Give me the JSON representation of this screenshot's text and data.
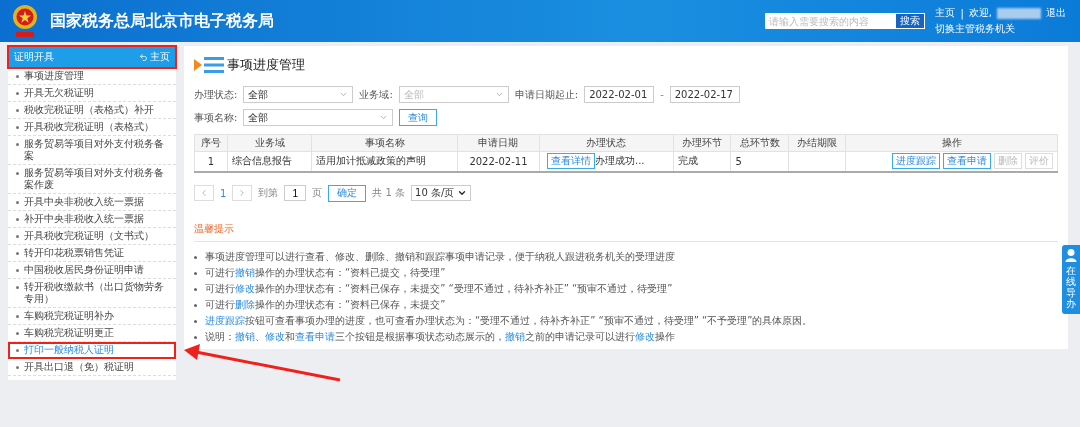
{
  "header": {
    "title": "国家税务总局北京市电子税务局",
    "search": {
      "placeholder": "请输入需要搜索的内容",
      "button": "搜索"
    },
    "home": "主页",
    "separator": "|",
    "welcome": "欢迎,",
    "logout": "退出",
    "switch_org": "切换主管税务机关"
  },
  "sidebar": {
    "title": "证明开具",
    "home_link": "主页",
    "annotated": true,
    "items": [
      {
        "label": "事项进度管理",
        "selected": false,
        "annotated": false
      },
      {
        "label": "开具无欠税证明",
        "selected": false,
        "annotated": false
      },
      {
        "label": "税收完税证明（表格式）补开",
        "selected": false,
        "annotated": false
      },
      {
        "label": "开具税收完税证明（表格式）",
        "selected": false,
        "annotated": false
      },
      {
        "label": "服务贸易等项目对外支付税务备案",
        "selected": false,
        "annotated": false
      },
      {
        "label": "服务贸易等项目对外支付税务备案作废",
        "selected": false,
        "annotated": false
      },
      {
        "label": "开具中央非税收入统一票据",
        "selected": false,
        "annotated": false
      },
      {
        "label": "补开中央非税收入统一票据",
        "selected": false,
        "annotated": false
      },
      {
        "label": "开具税收完税证明（文书式）",
        "selected": false,
        "annotated": false
      },
      {
        "label": "转开印花税票销售凭证",
        "selected": false,
        "annotated": false
      },
      {
        "label": "中国税收居民身份证明申请",
        "selected": false,
        "annotated": false
      },
      {
        "label": "转开税收缴款书（出口货物劳务专用）",
        "selected": false,
        "annotated": false
      },
      {
        "label": "车购税完税证明补办",
        "selected": false,
        "annotated": false
      },
      {
        "label": "车购税完税证明更正",
        "selected": false,
        "annotated": false
      },
      {
        "label": "打印一般纳税人证明",
        "selected": true,
        "annotated": true
      },
      {
        "label": "开具出口退（免）税证明",
        "selected": false,
        "annotated": false
      }
    ]
  },
  "main": {
    "title": "事项进度管理",
    "filter_rows": [
      [
        {
          "kind": "select",
          "label": "办理状态:",
          "value": "全部",
          "disabled": false
        },
        {
          "kind": "select",
          "label": "业务域:",
          "value": "全部",
          "disabled": true
        },
        {
          "kind": "date",
          "label": "申请日期起止:",
          "value": "2022-02-01"
        },
        {
          "kind": "dash",
          "text": "-"
        },
        {
          "kind": "date",
          "value": "2022-02-17"
        }
      ],
      [
        {
          "kind": "select",
          "label": "事项名称:",
          "value": "全部",
          "disabled": false
        },
        {
          "kind": "button",
          "label": "查询"
        }
      ]
    ],
    "table": {
      "columns": [
        "序号",
        "业务域",
        "事项名称",
        "申请日期",
        "办理状态",
        "办理环节",
        "总环节数",
        "办结期限",
        "操作"
      ],
      "rows": [
        {
          "index": "1",
          "domain": "综合信息报告",
          "name": "适用加计抵减政策的声明",
          "date": "2022-02-11",
          "status_button": "查看详情",
          "status": "办理成功...",
          "step": "完成",
          "total_steps": "5",
          "actions": [
            {
              "label": "进度跟踪",
              "disabled": false
            },
            {
              "label": "查看申请",
              "disabled": false
            },
            {
              "label": "删除",
              "disabled": true
            },
            {
              "label": "评价",
              "disabled": true
            }
          ]
        }
      ]
    },
    "pagination": {
      "page": "1",
      "goto": "到第",
      "goto_value": "1",
      "page_unit": "页",
      "confirm": "确定",
      "total": "共 1 条",
      "page_size": "10 条/页"
    },
    "tips": {
      "title": "温馨提示",
      "items": [
        [
          {
            "text": "事项进度管理可以进行查看、修改、删除、撤销和跟踪事项申请记录，便于纳税人跟进税务机关的受理进度",
            "link": false
          }
        ],
        [
          {
            "text": "可进行",
            "link": false
          },
          {
            "text": "撤销",
            "link": true
          },
          {
            "text": "操作的办理状态有：“资料已提交，待受理”",
            "link": false
          }
        ],
        [
          {
            "text": "可进行",
            "link": false
          },
          {
            "text": "修改",
            "link": true
          },
          {
            "text": "操作的办理状态有：“资料已保存，未提交” “受理不通过，待补齐补正” “预审不通过，待受理”",
            "link": false
          }
        ],
        [
          {
            "text": "可进行",
            "link": false
          },
          {
            "text": "删除",
            "link": true
          },
          {
            "text": "操作的办理状态有：“资料已保存，未提交”",
            "link": false
          }
        ],
        [
          {
            "text": "进度跟踪",
            "link": true
          },
          {
            "text": "按钮可查看事项办理的进度，也可查看办理状态为：“受理不通过，待补齐补正” “预审不通过，待受理” “不予受理”的具体原因。",
            "link": false
          }
        ],
        [
          {
            "text": "说明：",
            "link": false
          },
          {
            "text": "撤销",
            "link": true
          },
          {
            "text": "、",
            "link": false
          },
          {
            "text": "修改",
            "link": true
          },
          {
            "text": "和",
            "link": false
          },
          {
            "text": "查看申请",
            "link": true
          },
          {
            "text": "三个按钮是根据事项状态动态展示的，",
            "link": false
          },
          {
            "text": "撤销",
            "link": true
          },
          {
            "text": "之前的申请记录可以进行",
            "link": false
          },
          {
            "text": "修改",
            "link": true
          },
          {
            "text": "操作",
            "link": false
          }
        ]
      ]
    }
  },
  "helper": {
    "label": "在线导办"
  }
}
